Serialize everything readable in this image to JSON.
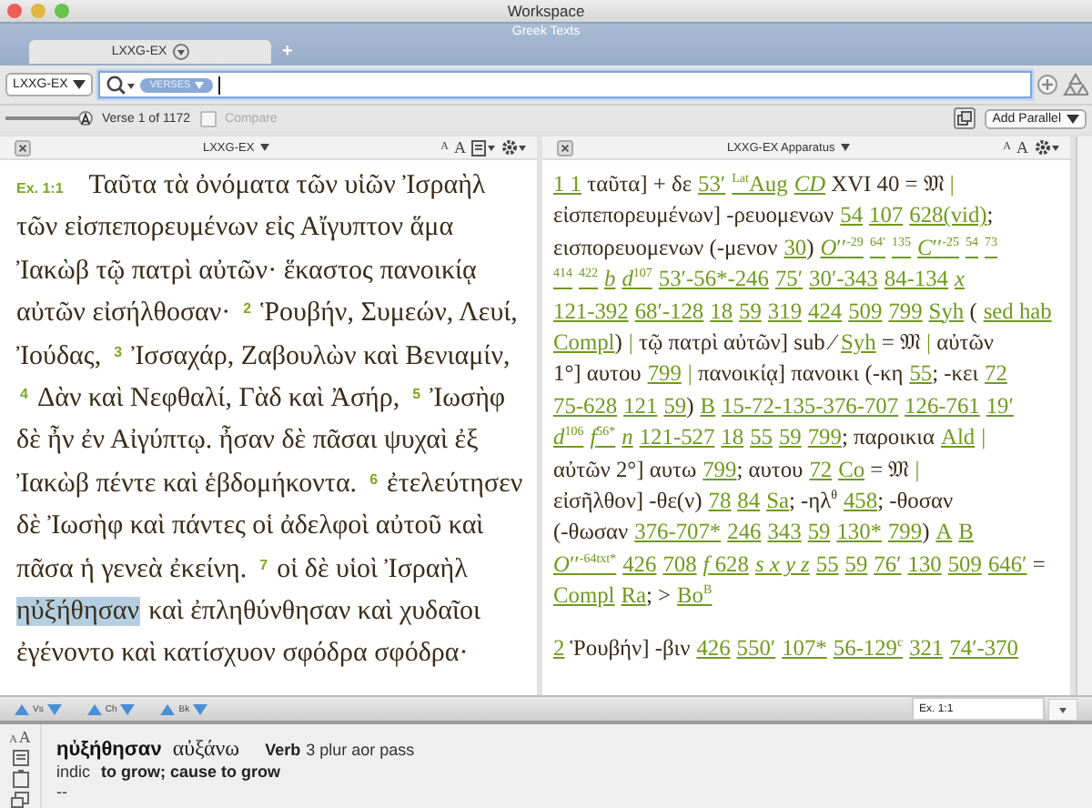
{
  "window": {
    "title": "Workspace"
  },
  "workspace": {
    "title": "Greek Texts",
    "tabs": [
      {
        "label": "LXXG-EX",
        "selected": true
      }
    ],
    "new_tab": "+"
  },
  "search_bar": {
    "resource": "LXXG-EX",
    "scope_token": "VERSES"
  },
  "verse_bar": {
    "text_size": {
      "level": 1
    },
    "position": "Verse 1 of 1172",
    "compare": {
      "label": "Compare",
      "checked": false,
      "disabled": true
    },
    "add_parallel": "Add Parallel"
  },
  "panes": [
    {
      "kind": "text",
      "title": "LXXG-EX",
      "size_buttons": [
        "A",
        "A"
      ],
      "lines": [
        [
          {
            "ref": "Ex. 1:1"
          },
          "Ταῦτα τὰ ὀνόματα τῶν υἱῶν Ἰσραὴλ"
        ],
        [
          "τῶν εἰσπεπορευμένων εἰς Αἴγυπτον ἅμα"
        ],
        [
          "Ἰακὼβ τῷ πατρὶ αὐτῶν· ἕκαστος πανοικίᾳ"
        ],
        [
          "αὐτῶν εἰσήλθοσαν·",
          {
            "verse": "2"
          },
          "Ῥουβήν, Συμεών, Λευί,"
        ],
        [
          "Ἰούδας,",
          {
            "verse": "3"
          },
          "Ἰσσαχάρ, Ζαβουλὼν καὶ Βενιαμίν,"
        ],
        [
          {
            "verse": "4"
          },
          "Δὰν καὶ Νεφθαλί, Γὰδ καὶ Ἀσήρ,",
          {
            "verse": "5"
          },
          "Ἰωσὴφ"
        ],
        [
          "δὲ ἦν ἐν Αἰγύπτῳ. ἦσαν δὲ πᾶσαι ψυχαὶ ἐξ"
        ],
        [
          "Ἰακὼβ πέντε καὶ ἑβδομήκοντα.",
          {
            "verse": "6"
          },
          "ἐτελεύτησεν"
        ],
        [
          "δὲ Ἰωσὴφ καὶ πάντες οἱ ἀδελφοὶ αὐτοῦ καὶ"
        ],
        [
          "πᾶσα ἡ γενεὰ ἐκείνη.",
          {
            "verse": "7"
          },
          "οἱ δὲ υἱοὶ Ἰσραὴλ"
        ],
        [
          {
            "word": "ηὐξήθησαν",
            "selected": true
          },
          "καὶ ἐπληθύνθησαν καὶ χυδαῖοι"
        ],
        [
          "ἐγένοντο καὶ κατίσχυον σφόδρα σφόδρα·"
        ]
      ]
    },
    {
      "kind": "apparatus",
      "title": "LXXG-EX Apparatus",
      "size_buttons": [
        "A",
        "A"
      ],
      "paragraphs": [
        [
          [
            {
              "link": "1 1"
            },
            " ταῦτα] + δε",
            {
              "link": "53′"
            },
            {
              "link": "$^{Lat}$Aug"
            },
            {
              "link": "*CD*"
            },
            " XVI 40 = 𝔐",
            {
              "link": "|"
            }
          ],
          [
            "εἰσπεπορευμένων] -ρευομενων",
            {
              "link": "54"
            },
            {
              "link": "107"
            },
            {
              "link": "628(vid)"
            },
            ";"
          ],
          [
            "εισπορευομενων (-μενον",
            {
              "link": "30"
            },
            ")",
            {
              "link": "*O*′′$^{-29}$"
            },
            {
              "link": "$^{64′}$"
            },
            {
              "link": "$^{135}$"
            },
            {
              "link": "*C*′′$^{-25}$"
            },
            {
              "link": "$^{54}$"
            },
            {
              "link": "$^{73}$"
            }
          ],
          [
            {
              "link": "$^{414}$"
            },
            {
              "link": "$^{422}$"
            },
            {
              "link": "*b*"
            },
            {
              "link": "*d*$^{107}$"
            },
            {
              "link": "53′-56*-246"
            },
            {
              "link": "75′"
            },
            {
              "link": "30′-343"
            },
            {
              "link": "84-134"
            },
            {
              "link": "*x*"
            }
          ],
          [
            {
              "link": "121-392"
            },
            {
              "link": "68′-128"
            },
            {
              "link": "18"
            },
            {
              "link": "59"
            },
            {
              "link": "319"
            },
            {
              "link": "424"
            },
            {
              "link": "509"
            },
            {
              "link": "799"
            },
            {
              "link": "Syh"
            },
            " (",
            {
              "link": "sed hab"
            }
          ],
          [
            {
              "link": "Compl"
            },
            ")",
            {
              "link": "|"
            },
            " τῷ πατρὶ αὐτῶν] sub ⁄",
            {
              "link": "Syh"
            },
            " = 𝔐",
            {
              "link": "|"
            },
            " αὐτῶν"
          ],
          [
            "1°] αυτου",
            {
              "link": "799"
            },
            {
              "link": "|"
            },
            " πανοικίᾳ] πανοικι (-κη",
            {
              "link": "55"
            },
            "; -κει",
            {
              "link": "72"
            }
          ],
          [
            {
              "link": "75-628"
            },
            {
              "link": "121"
            },
            {
              "link": "59"
            },
            ")",
            {
              "link": "B"
            },
            {
              "link": "15-72-135-376-707"
            },
            {
              "link": "126-761"
            },
            {
              "link": "19′"
            }
          ],
          [
            {
              "link": "*d*$^{106}$"
            },
            {
              "link": "*f*$^{56*}$"
            },
            {
              "link": "*n*"
            },
            {
              "link": "121-527"
            },
            {
              "link": "18"
            },
            {
              "link": "55"
            },
            {
              "link": "59"
            },
            {
              "link": "799"
            },
            "; παροικια",
            {
              "link": "Ald"
            },
            {
              "link": "|"
            }
          ],
          [
            "αὐτῶν 2°] αυτω",
            {
              "link": "799"
            },
            "; αυτου",
            {
              "link": "72"
            },
            {
              "link": "Co"
            },
            " = 𝔐",
            {
              "link": "|"
            }
          ],
          [
            "εἰσῆλθον] -θε(ν)",
            {
              "link": "78"
            },
            {
              "link": "84"
            },
            {
              "link": "Sa"
            },
            "; -ηλ$^{θ}$",
            {
              "link": "458"
            },
            "; -θοσαν"
          ],
          [
            "(-θωσαν",
            {
              "link": "376-707*"
            },
            {
              "link": "246"
            },
            {
              "link": "343"
            },
            {
              "link": "59"
            },
            {
              "link": "130*"
            },
            {
              "link": "799"
            },
            ")",
            {
              "link": "A"
            },
            {
              "link": "B"
            }
          ],
          [
            {
              "link": "*O*′′$^{-64txt*}$"
            },
            {
              "link": "426"
            },
            {
              "link": "708"
            },
            {
              "link": "*f* 628"
            },
            {
              "link": "*s x y z*"
            },
            {
              "link": "55"
            },
            {
              "link": "59"
            },
            {
              "link": "76′"
            },
            {
              "link": "130"
            },
            {
              "link": "509"
            },
            {
              "link": "646′"
            },
            " ="
          ],
          [
            {
              "link": "Compl"
            },
            {
              "link": "Ra"
            },
            "; >",
            {
              "link": "Bo$^{B}$"
            }
          ]
        ],
        [
          [
            {
              "link": "2"
            },
            " Ῥουβήν] -βιν",
            {
              "link": "426"
            },
            {
              "link": "550′"
            },
            {
              "link": "107*"
            },
            {
              "link": "56-129$^{c}$"
            },
            {
              "link": "321"
            },
            {
              "link": "74′-370"
            }
          ]
        ]
      ]
    }
  ],
  "nav": [
    "Vs",
    "Ch",
    "Bk"
  ],
  "reference_field": {
    "value": "Ex. 1:1"
  },
  "info": {
    "size_buttons": [
      "A",
      "A"
    ],
    "word": "ηὐξήθησαν",
    "lemma": "αὐξάνω",
    "pos": "Verb",
    "parse": "3 plur aor pass",
    "parse_cont": "indic",
    "gloss": "to grow; cause to grow",
    "extra": "--"
  }
}
